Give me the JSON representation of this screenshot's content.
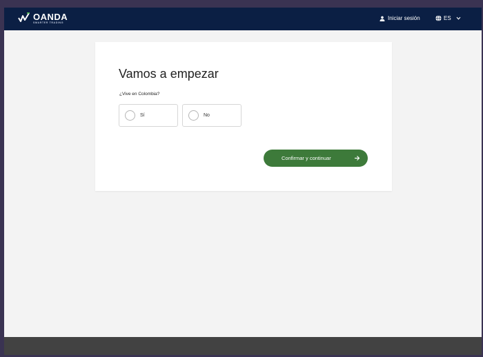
{
  "header": {
    "brand": "OANDA",
    "tagline": "SMARTER TRADING",
    "login_label": "Iniciar sesión",
    "language_label": "ES",
    "background_color": "#0b1f44",
    "logo_accent_color": "#4caf50"
  },
  "form": {
    "title": "Vamos a empezar",
    "question": "¿Vive en Colombia?",
    "options": [
      {
        "label": "Sí",
        "selected": false
      },
      {
        "label": "No",
        "selected": false
      }
    ],
    "confirm_label": "Confirmar y continuar",
    "confirm_color": "#3d7a3a"
  },
  "icons": [
    "oanda-logo-icon",
    "user-icon",
    "globe-icon",
    "chevron-down-icon",
    "arrow-right-icon"
  ]
}
